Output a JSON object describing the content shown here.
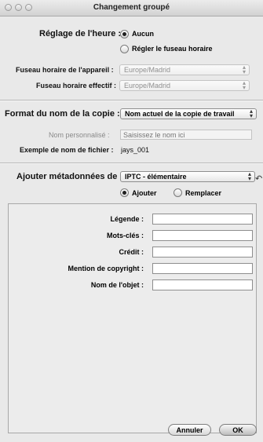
{
  "window": {
    "title": "Changement groupé"
  },
  "time_setting": {
    "label": "Réglage de l'heure :",
    "option_none": "Aucun",
    "option_adjust": "Régler le fuseau horaire",
    "device_tz_label": "Fuseau horaire de l'appareil :",
    "device_tz_value": "Europe/Madrid",
    "effective_tz_label": "Fuseau horaire effectif :",
    "effective_tz_value": "Europe/Madrid"
  },
  "copy_name": {
    "label": "Format du nom de la copie :",
    "value": "Nom actuel de la copie de travail",
    "custom_label": "Nom personnalisé :",
    "custom_placeholder": "Saisissez le nom ici",
    "example_label": "Exemple de nom de fichier :",
    "example_value": "jays_001"
  },
  "metadata": {
    "label": "Ajouter métadonnées de :",
    "value": "IPTC - élémentaire",
    "option_add": "Ajouter",
    "option_replace": "Remplacer",
    "fields": [
      {
        "label": "Légende :",
        "value": ""
      },
      {
        "label": "Mots-clés :",
        "value": ""
      },
      {
        "label": "Crédit :",
        "value": ""
      },
      {
        "label": "Mention de copyright :",
        "value": ""
      },
      {
        "label": "Nom de l'objet :",
        "value": ""
      }
    ]
  },
  "buttons": {
    "cancel": "Annuler",
    "ok": "OK"
  }
}
